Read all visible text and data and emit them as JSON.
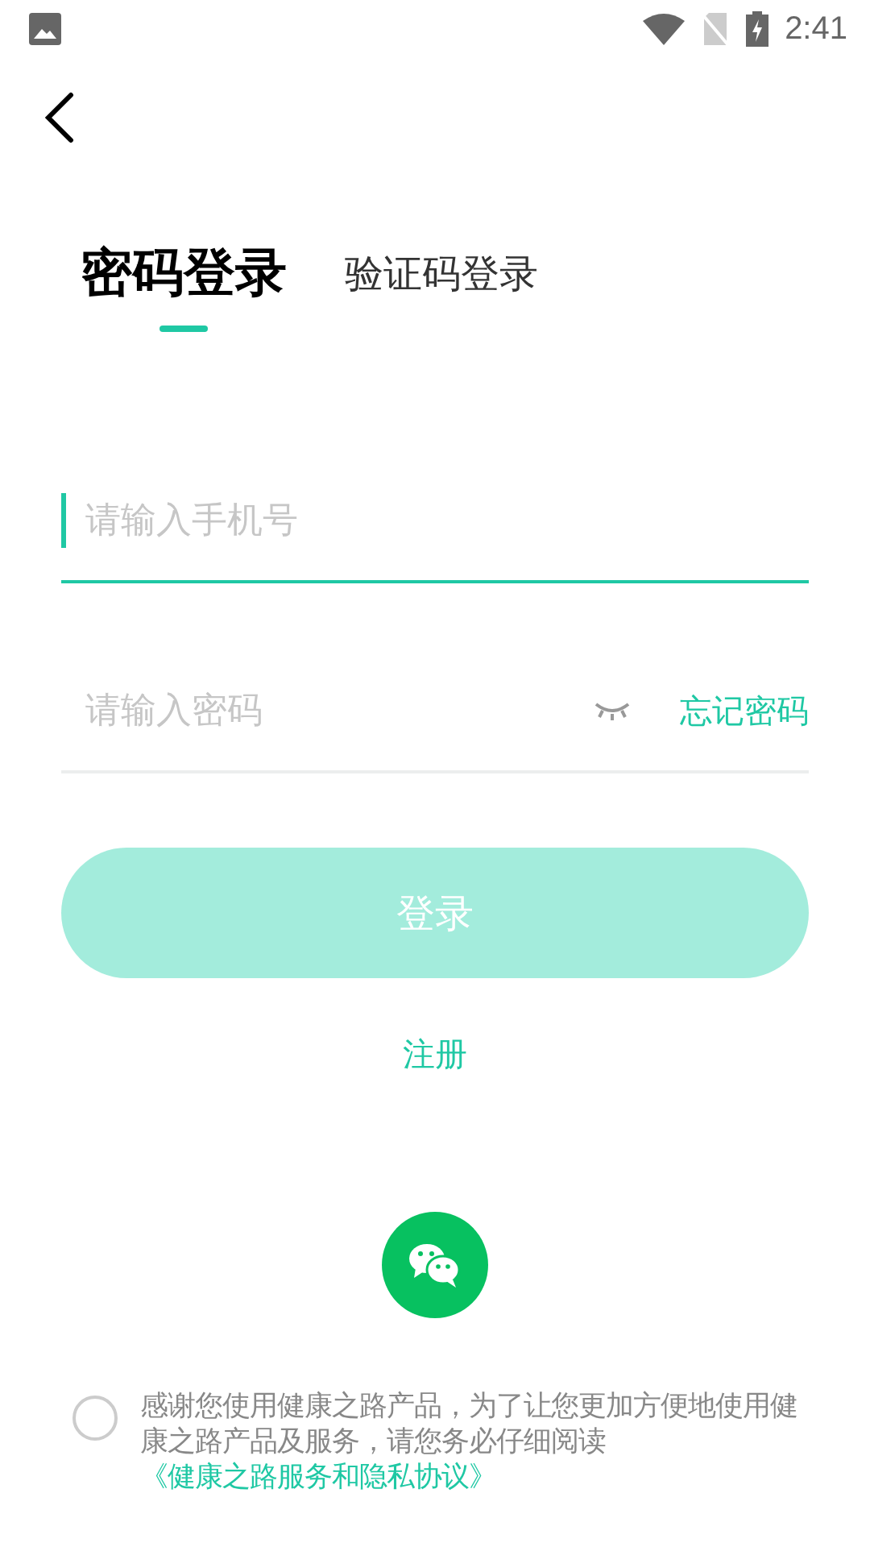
{
  "status_bar": {
    "time": "2:41"
  },
  "tabs": [
    {
      "label": "密码登录",
      "selected": true
    },
    {
      "label": "验证码登录",
      "selected": false
    }
  ],
  "phone_field": {
    "placeholder": "请输入手机号",
    "focused": true
  },
  "password_field": {
    "placeholder": "请输入密码",
    "visible": false
  },
  "forgot_link": "忘记密码",
  "login_button": {
    "label": "登录",
    "disabled": true
  },
  "register_link": "注册",
  "agreement": {
    "checked": false,
    "text": "感谢您使用健康之路产品，为了让您更加方便地使用健康之路产品及服务，请您务必仔细阅读",
    "link": "《健康之路服务和隐私协议》"
  }
}
